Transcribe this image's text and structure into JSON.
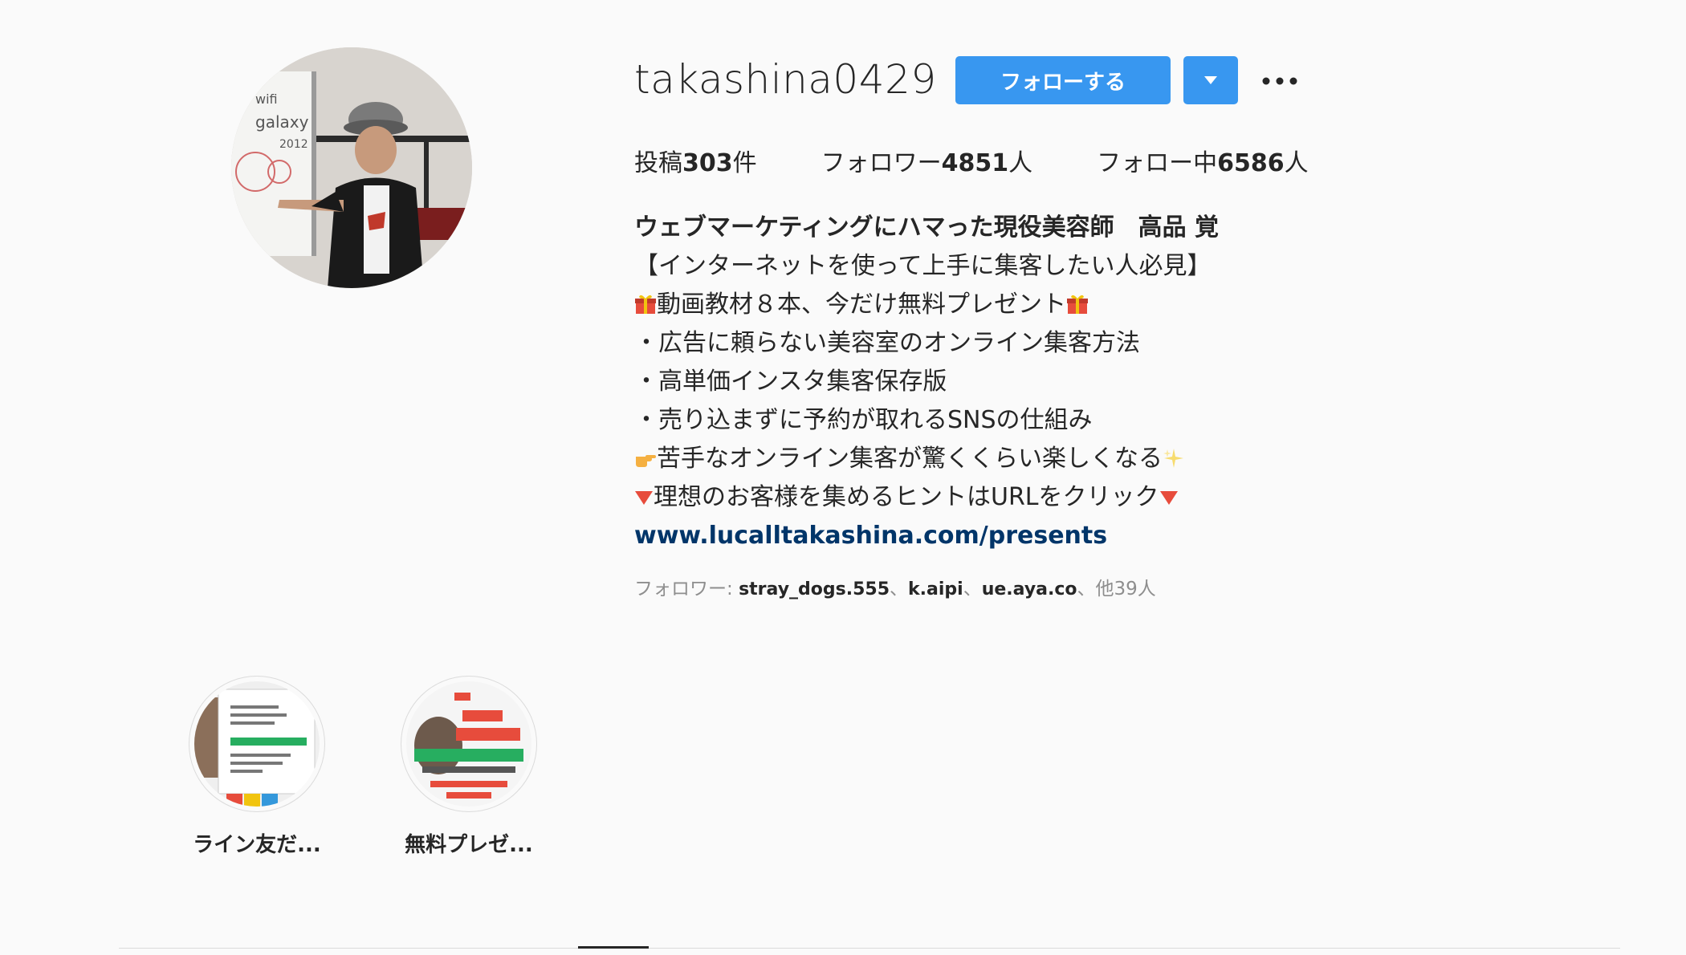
{
  "profile": {
    "username": "takashina0429",
    "follow_label": "フォローする",
    "dropdown_icon": "caret-down-icon",
    "more_icon": "ellipsis-icon"
  },
  "stats": {
    "posts_prefix": "投稿",
    "posts_count": "303",
    "posts_suffix": "件",
    "followers_prefix": "フォロワー",
    "followers_count": "4851",
    "followers_suffix": "人",
    "following_prefix": "フォロー中",
    "following_count": "6586",
    "following_suffix": "人"
  },
  "bio": {
    "name": "ウェブマーケティングにハマった現役美容師　高品 覚",
    "line1": "【インターネットを使って上手に集客したい人必見】",
    "line2": "動画教材８本、今だけ無料プレゼント",
    "line3": "・広告に頼らない美容室のオンライン集客方法",
    "line4": "・高単価インスタ集客保存版",
    "line5": "・売り込まずに予約が取れるSNSの仕組み",
    "line6": "苦手なオンライン集客が驚くくらい楽しくなる",
    "line7": "理想のお客様を集めるヒントはURLをクリック",
    "link": "www.lucalltakashina.com/presents"
  },
  "followed_by": {
    "prefix": "フォロワー: ",
    "accounts": [
      "stray_dogs.555",
      "k.aipi",
      "ue.aya.co"
    ],
    "separator": "、",
    "others": "他39人"
  },
  "highlights": [
    {
      "label": "ライン友だ..."
    },
    {
      "label": "無料プレゼ..."
    }
  ],
  "colors": {
    "accent": "#3897f0",
    "link": "#003569",
    "background": "#fafafa"
  }
}
